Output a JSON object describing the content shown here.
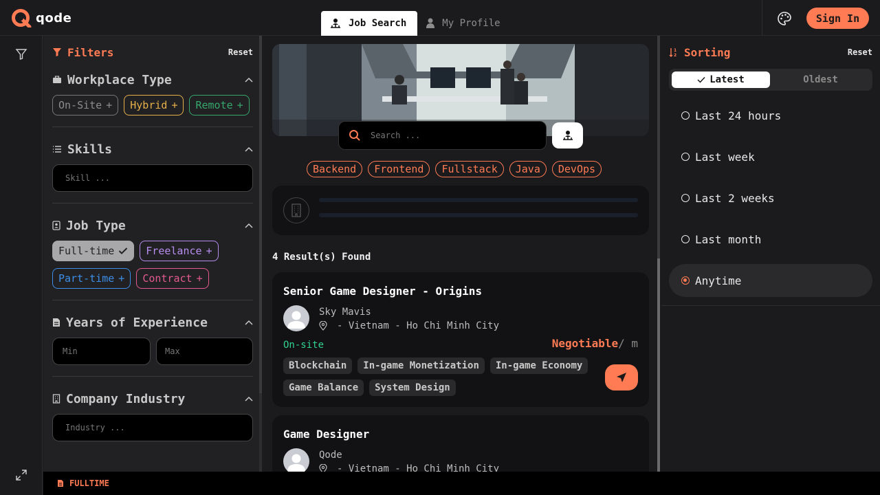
{
  "app": {
    "name": "qode",
    "accent": "#ff7b54"
  },
  "nav": {
    "tabs": [
      {
        "label": "Job Search",
        "icon": "user-hierarchy-icon"
      },
      {
        "label": "My Profile",
        "icon": "user-icon"
      }
    ]
  },
  "header": {
    "signin": "Sign In",
    "palette_icon": "palette-icon"
  },
  "filters": {
    "title": "Filters",
    "reset": "Reset",
    "workplace": {
      "title": "Workplace Type",
      "options": [
        "On-Site",
        "Hybrid",
        "Remote"
      ]
    },
    "skills": {
      "title": "Skills",
      "placeholder": "Skill ..."
    },
    "job_type": {
      "title": "Job Type",
      "options": [
        "Full-time",
        "Freelance",
        "Part-time",
        "Contract"
      ],
      "selected": "Full-time"
    },
    "experience": {
      "title": "Years of Experience",
      "min_placeholder": "Min",
      "max_placeholder": "Max"
    },
    "industry": {
      "title": "Company Industry",
      "placeholder": "Industry ..."
    }
  },
  "search": {
    "placeholder": "Search ..."
  },
  "tags": [
    "Backend",
    "Frontend",
    "Fullstack",
    "Java",
    "DevOps"
  ],
  "results": {
    "count_label": "4 Result(s) Found"
  },
  "jobs": [
    {
      "title": "Senior Game Designer - Origins",
      "company": "Sky Mavis",
      "location": "- Vietnam - Ho Chi Minh City",
      "workplace": "On-site",
      "salary": "Negotiable",
      "per": "/ m",
      "skills": [
        "Blockchain",
        "In-game Monetization",
        "In-game Economy",
        "Game Balance",
        "System Design"
      ]
    },
    {
      "title": "Game Designer",
      "company": "Qode",
      "location": "- Vietnam - Ho Chi Minh City"
    }
  ],
  "sorting": {
    "title": "Sorting",
    "reset": "Reset",
    "order": {
      "latest": "Latest",
      "oldest": "Oldest",
      "selected": "Latest"
    },
    "ranges": [
      "Last 24 hours",
      "Last week",
      "Last 2 weeks",
      "Last month",
      "Anytime"
    ],
    "selected_range": "Anytime"
  },
  "footer": {
    "label": "FULLTIME"
  }
}
